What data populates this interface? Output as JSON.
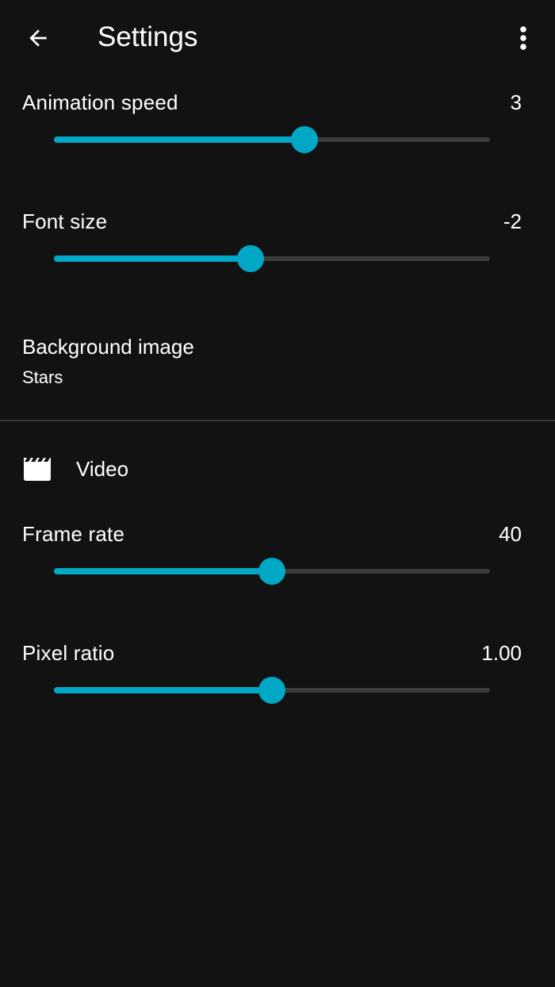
{
  "appbar": {
    "title": "Settings",
    "back_icon": "arrow-left-icon",
    "overflow_icon": "more-vertical-icon"
  },
  "general": {
    "animation_speed": {
      "label": "Animation speed",
      "value": "3",
      "fraction": 0.575
    },
    "font_size": {
      "label": "Font size",
      "value": "-2",
      "fraction": 0.45
    },
    "background_image": {
      "title": "Background image",
      "summary": "Stars"
    }
  },
  "video": {
    "title": "Video",
    "icon": "clapperboard-icon",
    "frame_rate": {
      "label": "Frame rate",
      "value": "40",
      "fraction": 0.5
    },
    "pixel_ratio": {
      "label": "Pixel ratio",
      "value": "1.00",
      "fraction": 0.5
    }
  },
  "colors": {
    "background": "#121212",
    "accent": "#00a8c6",
    "track": "#3b3b3b",
    "divider": "#3a3a3a",
    "text": "#ffffff"
  }
}
